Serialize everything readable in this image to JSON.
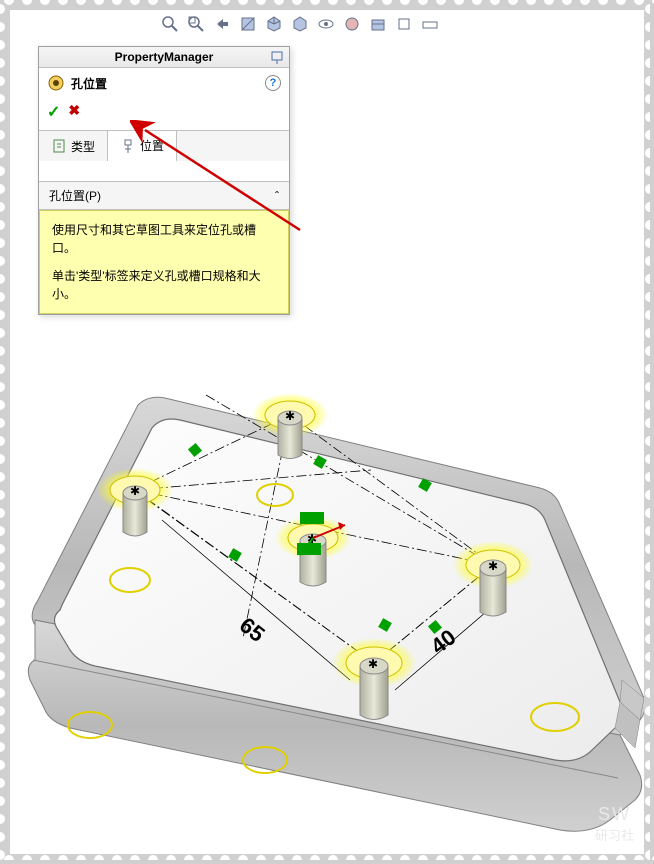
{
  "panel": {
    "header": "PropertyManager",
    "feature_title": "孔位置",
    "tab_type": "类型",
    "tab_position": "位置",
    "section_title": "孔位置(P)",
    "info_p1": "使用尺寸和其它草图工具来定位孔或槽口。",
    "info_p2": "单击'类型'标签来定义孔或槽口规格和大小。"
  },
  "dimensions": {
    "d1": "65",
    "d2": "40"
  },
  "watermark": {
    "line1": "SW",
    "line2": "研习社"
  }
}
